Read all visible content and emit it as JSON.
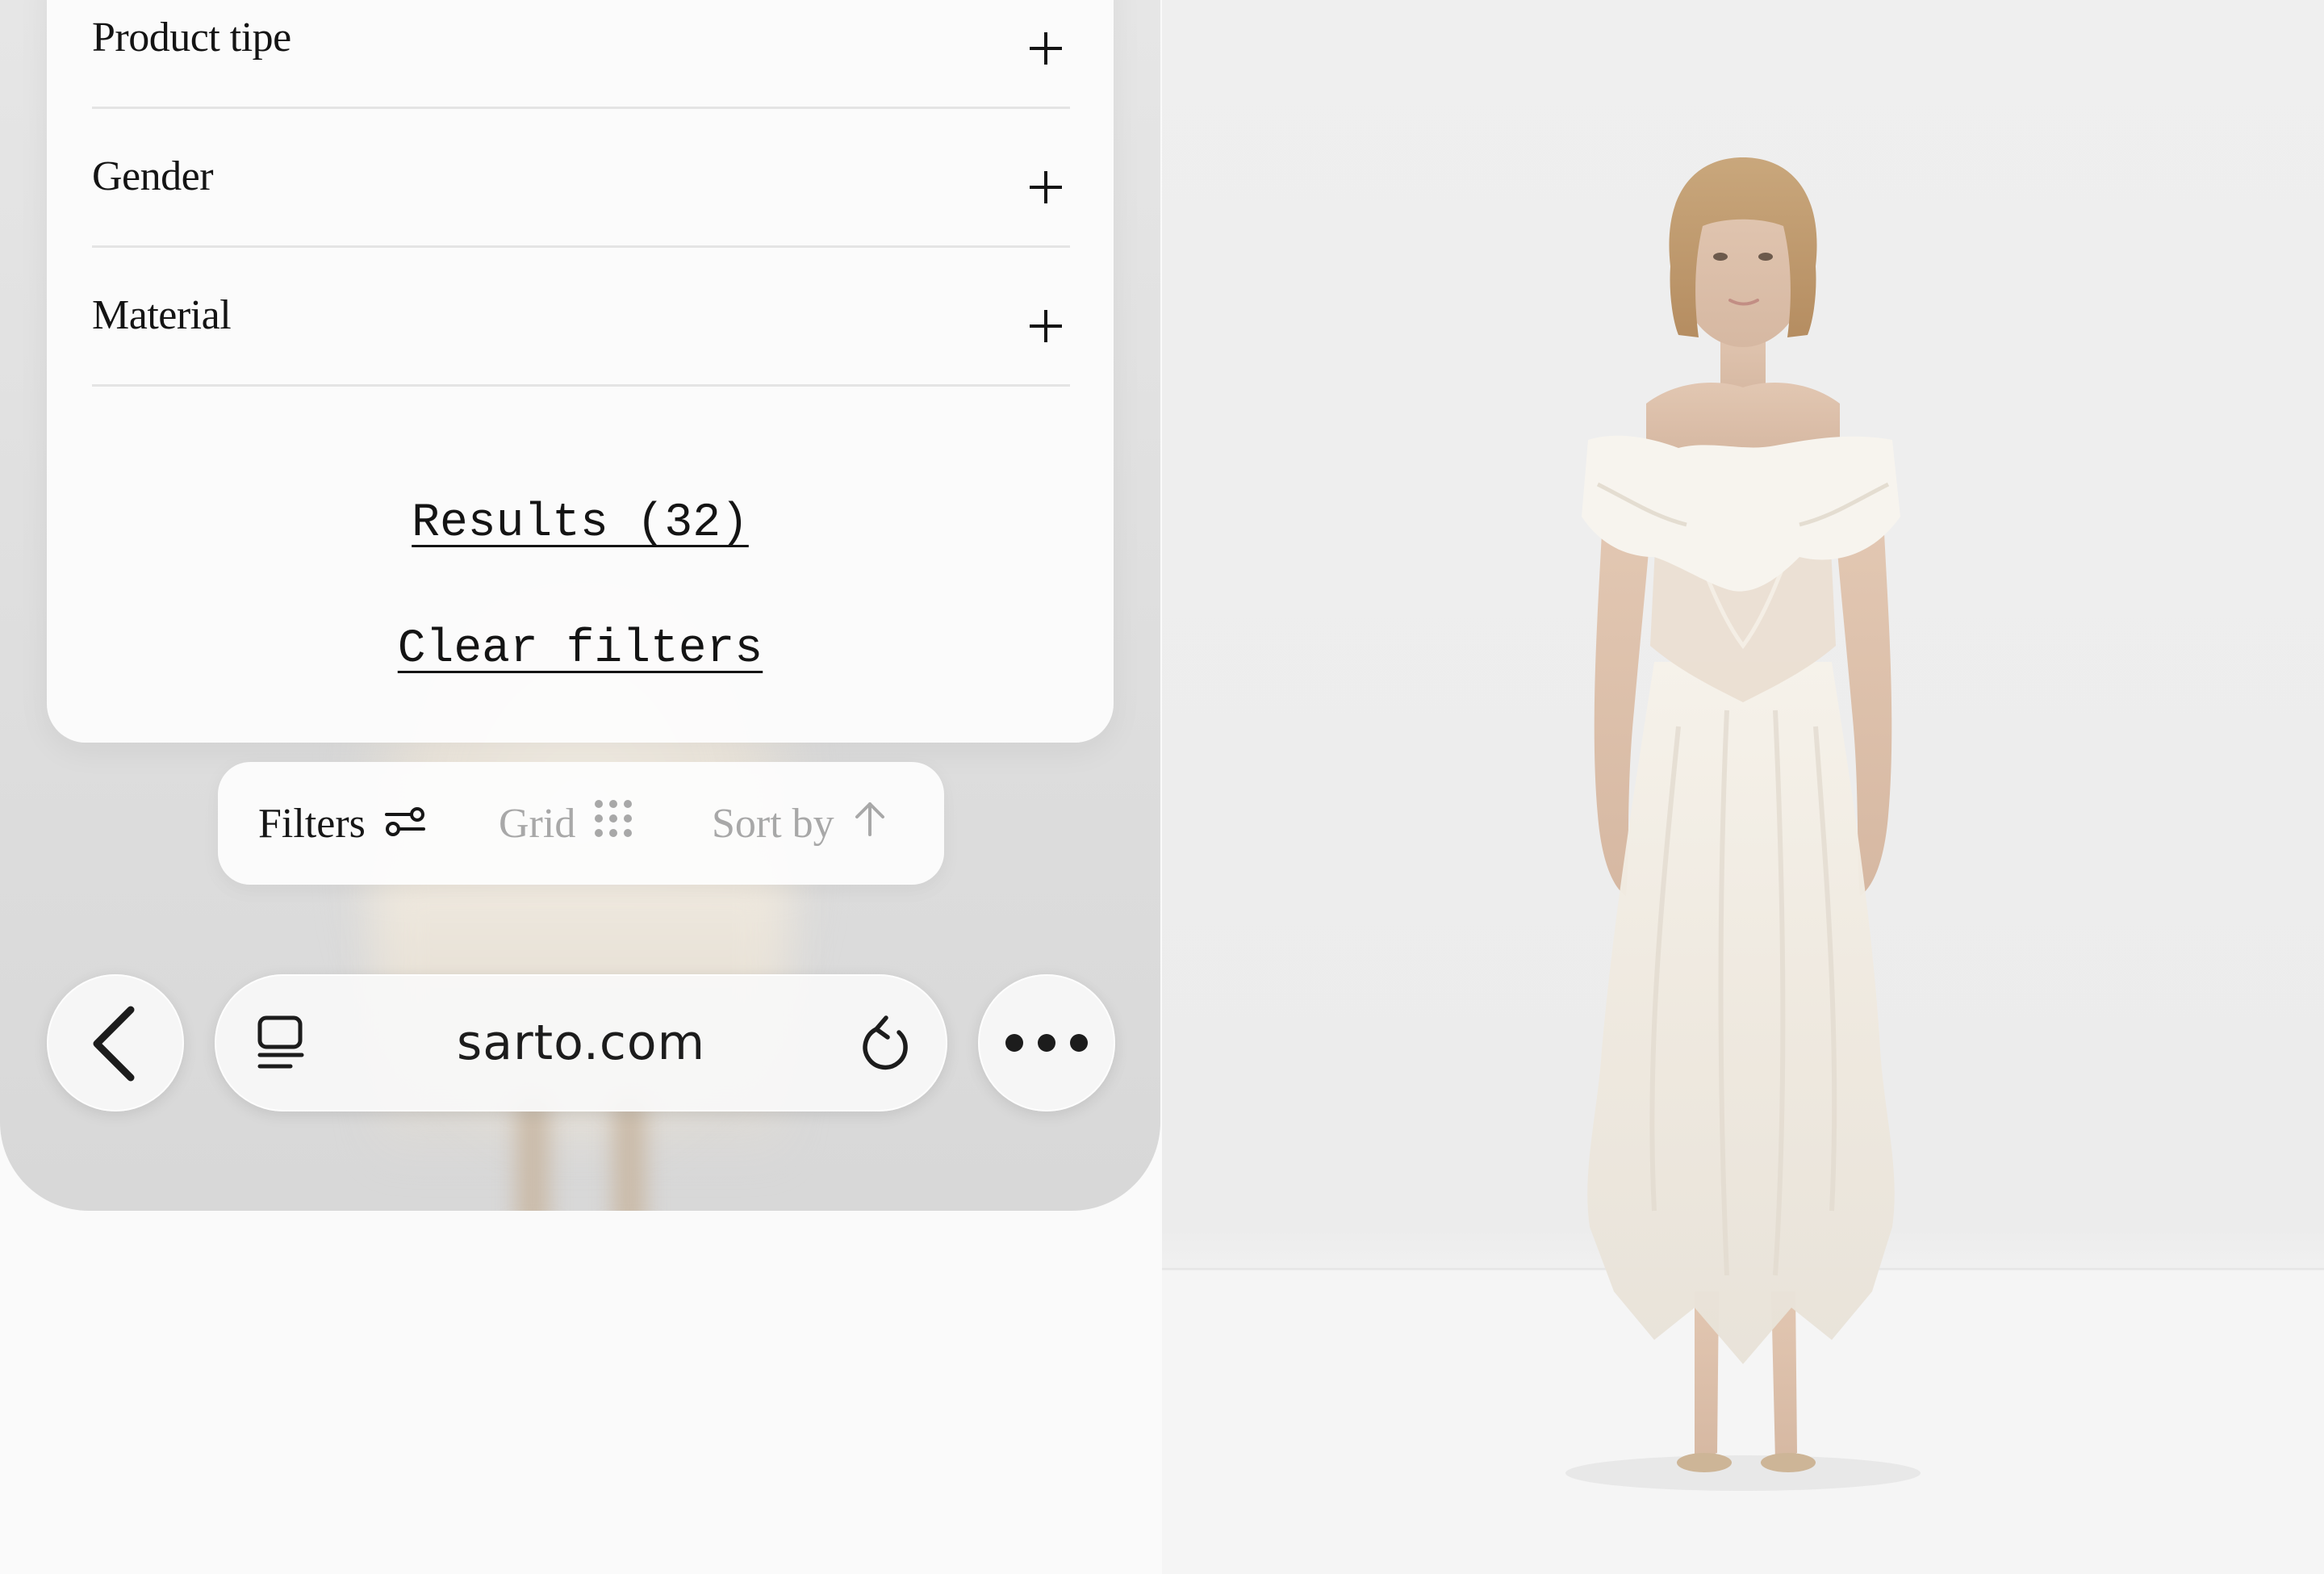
{
  "filters": {
    "items": [
      {
        "label": "Product tipe",
        "icon": "plus-icon"
      },
      {
        "label": "Gender",
        "icon": "plus-icon"
      },
      {
        "label": "Material",
        "icon": "plus-icon"
      }
    ],
    "results_label": "Results (32)",
    "clear_label": "Clear filters"
  },
  "toolbar": {
    "filters_label": "Filters",
    "filters_icon": "sliders-icon",
    "grid_label": "Grid",
    "grid_icon": "grid-dots-icon",
    "sort_label": "Sort by",
    "sort_icon": "arrow-up-icon"
  },
  "browser": {
    "url": "sarto.com",
    "back_icon": "chevron-left-icon",
    "reader_icon": "reader-mode-icon",
    "reload_icon": "reload-icon",
    "more_icon": "more-dots-icon"
  },
  "product_photo": {
    "subject": "model-in-white-dress"
  }
}
